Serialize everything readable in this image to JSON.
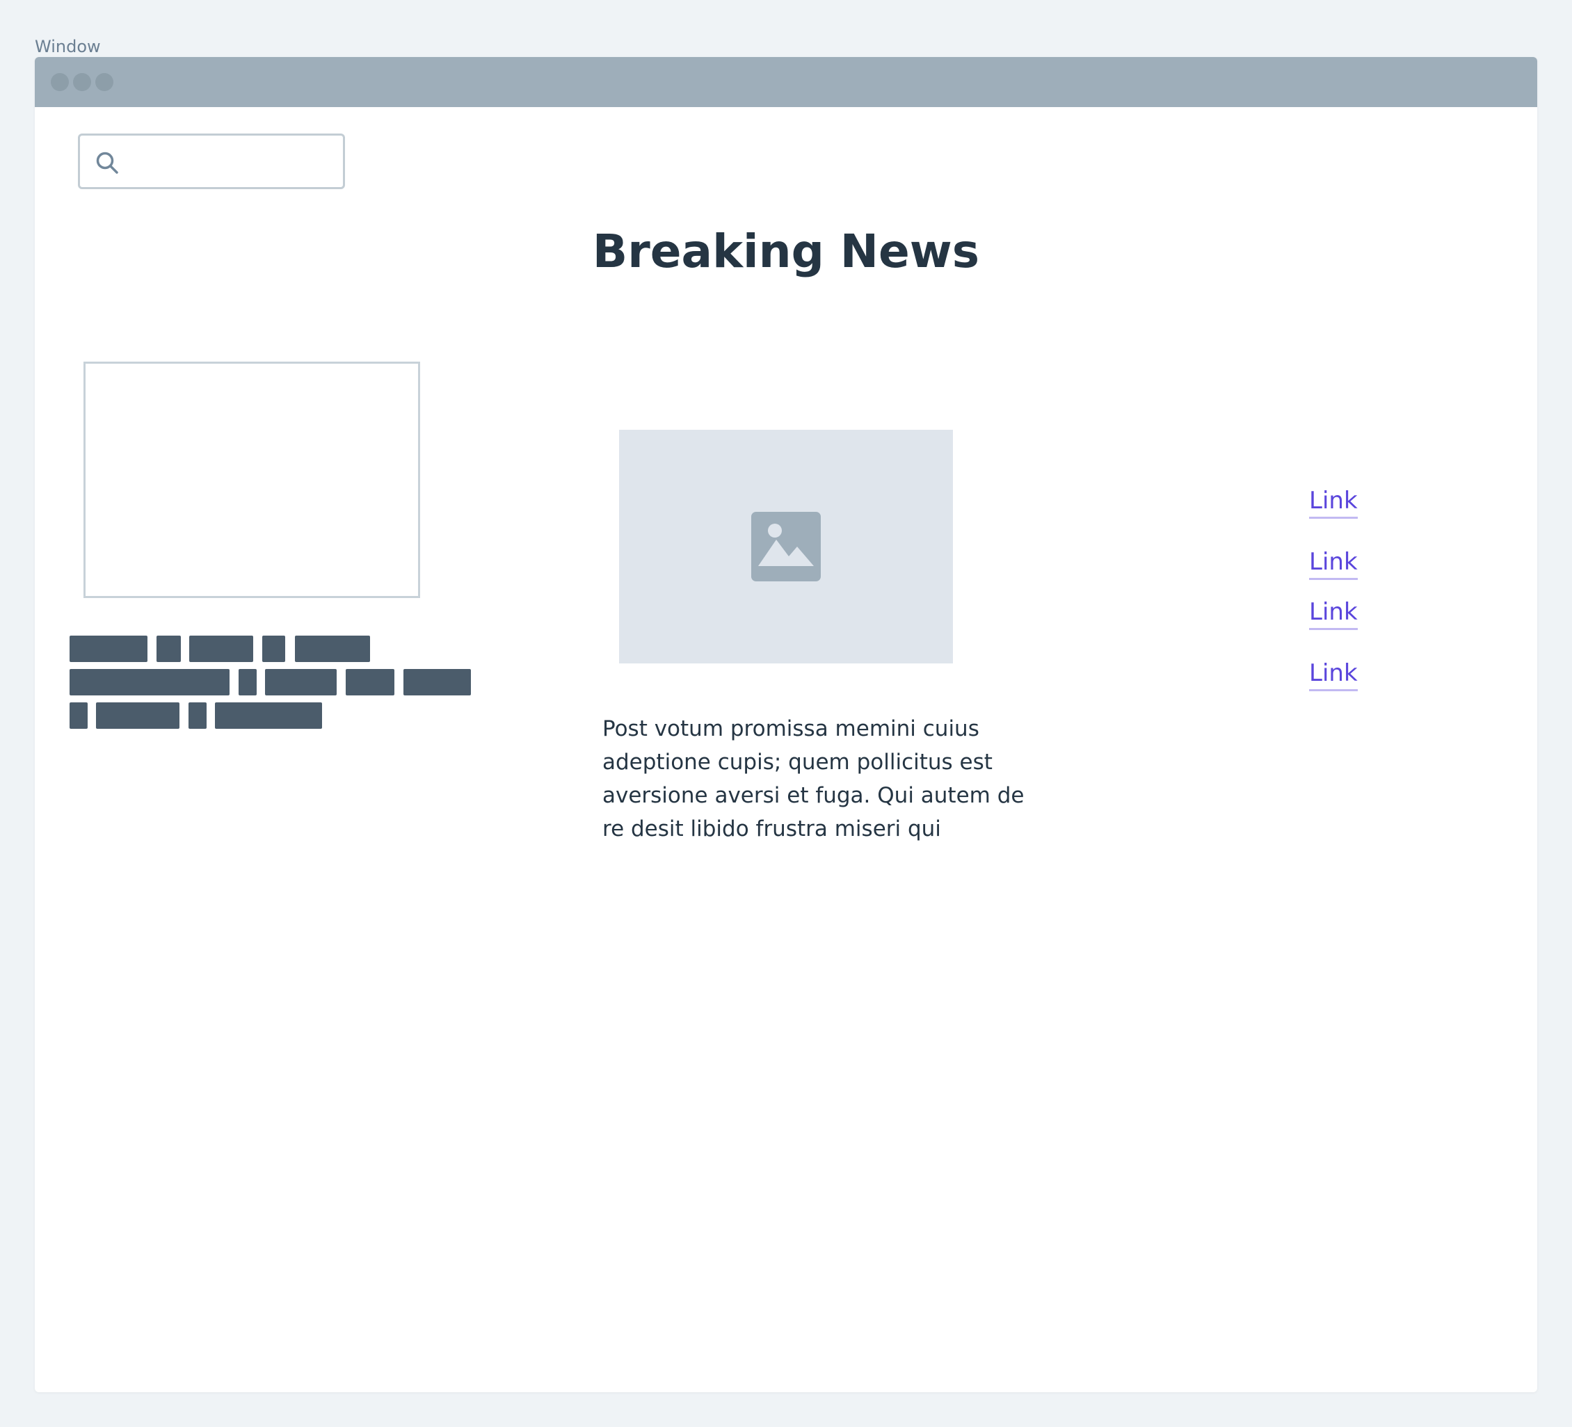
{
  "window": {
    "label": "Window"
  },
  "search": {
    "icon": "search-icon",
    "placeholder": "",
    "value": ""
  },
  "page": {
    "headline": "Breaking News"
  },
  "left_column": {
    "image": "image-placeholder-outline",
    "text": "redacted-text-blocks"
  },
  "main": {
    "image": "image-icon",
    "paragraph": "Post votum promissa memini cuius adeptione cupis; quem pollicitus est aversione aversi et fuga. Qui autem de re desit libido frustra miseri qui"
  },
  "links": [
    "Link",
    "Link",
    "Link",
    "Link"
  ],
  "colors": {
    "background": "#eff3f6",
    "titlebar": "#9eaeba",
    "heading": "#253543",
    "link": "#5a45dc",
    "link_underline": "#c2b9f2",
    "text_block": "#4b5c6b",
    "image_placeholder": "#dfe5ec"
  }
}
